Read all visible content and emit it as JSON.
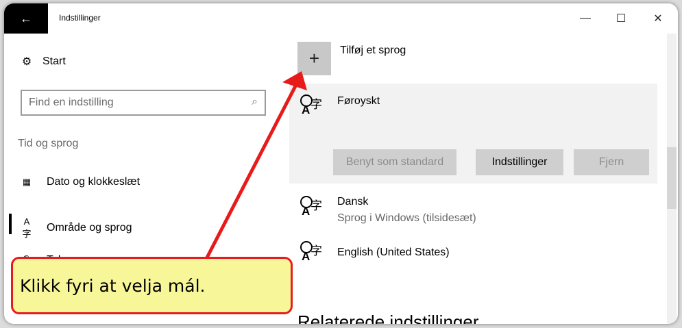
{
  "window": {
    "title": "Indstillinger",
    "back_icon": "←",
    "minimize_icon": "—",
    "maximize_icon": "☐",
    "close_icon": "✕"
  },
  "sidebar": {
    "start_label": "Start",
    "search_placeholder": "Find en indstilling",
    "section_title": "Tid og sprog",
    "items": [
      {
        "label": "Dato og klokkeslæt",
        "icon": "calendar-clock-icon"
      },
      {
        "label": "Område og sprog",
        "icon": "language-icon"
      },
      {
        "label": "Tale",
        "icon": "microphone-icon"
      }
    ]
  },
  "main": {
    "add_language_label": "Tilføj et sprog",
    "languages": [
      {
        "name": "Føroyskt",
        "subtitle": ""
      },
      {
        "name": "Dansk",
        "subtitle": "Sprog i Windows (tilsidesæt)"
      },
      {
        "name": "English (United States)",
        "subtitle": ""
      }
    ],
    "buttons": {
      "set_default": "Benyt som standard",
      "options": "Indstillinger",
      "remove": "Fjern"
    },
    "related_heading": "Relaterede indstillinger"
  },
  "annotation": {
    "callout_text": "Klikk fyri at velja mál.",
    "arrow_color": "#e81b1b",
    "callout_bg": "#f7f79a"
  }
}
